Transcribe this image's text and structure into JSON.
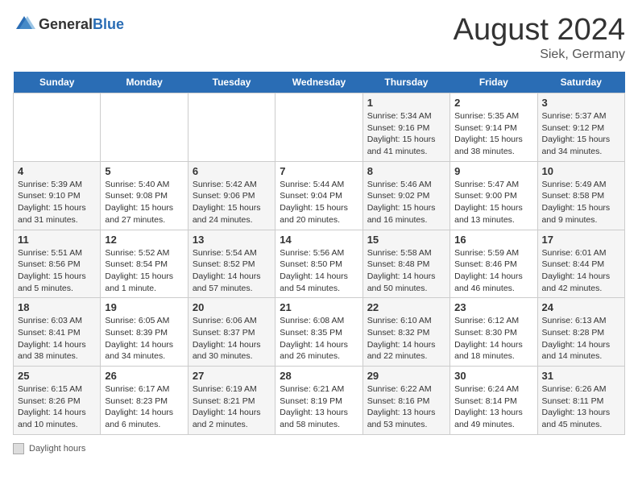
{
  "header": {
    "logo_general": "General",
    "logo_blue": "Blue",
    "month_year": "August 2024",
    "location": "Siek, Germany"
  },
  "days_of_week": [
    "Sunday",
    "Monday",
    "Tuesday",
    "Wednesday",
    "Thursday",
    "Friday",
    "Saturday"
  ],
  "footer": {
    "label": "Daylight hours"
  },
  "weeks": [
    {
      "cells": [
        {
          "date": "",
          "info": ""
        },
        {
          "date": "",
          "info": ""
        },
        {
          "date": "",
          "info": ""
        },
        {
          "date": "",
          "info": ""
        },
        {
          "date": "1",
          "info": "Sunrise: 5:34 AM\nSunset: 9:16 PM\nDaylight: 15 hours\nand 41 minutes."
        },
        {
          "date": "2",
          "info": "Sunrise: 5:35 AM\nSunset: 9:14 PM\nDaylight: 15 hours\nand 38 minutes."
        },
        {
          "date": "3",
          "info": "Sunrise: 5:37 AM\nSunset: 9:12 PM\nDaylight: 15 hours\nand 34 minutes."
        }
      ]
    },
    {
      "cells": [
        {
          "date": "4",
          "info": "Sunrise: 5:39 AM\nSunset: 9:10 PM\nDaylight: 15 hours\nand 31 minutes."
        },
        {
          "date": "5",
          "info": "Sunrise: 5:40 AM\nSunset: 9:08 PM\nDaylight: 15 hours\nand 27 minutes."
        },
        {
          "date": "6",
          "info": "Sunrise: 5:42 AM\nSunset: 9:06 PM\nDaylight: 15 hours\nand 24 minutes."
        },
        {
          "date": "7",
          "info": "Sunrise: 5:44 AM\nSunset: 9:04 PM\nDaylight: 15 hours\nand 20 minutes."
        },
        {
          "date": "8",
          "info": "Sunrise: 5:46 AM\nSunset: 9:02 PM\nDaylight: 15 hours\nand 16 minutes."
        },
        {
          "date": "9",
          "info": "Sunrise: 5:47 AM\nSunset: 9:00 PM\nDaylight: 15 hours\nand 13 minutes."
        },
        {
          "date": "10",
          "info": "Sunrise: 5:49 AM\nSunset: 8:58 PM\nDaylight: 15 hours\nand 9 minutes."
        }
      ]
    },
    {
      "cells": [
        {
          "date": "11",
          "info": "Sunrise: 5:51 AM\nSunset: 8:56 PM\nDaylight: 15 hours\nand 5 minutes."
        },
        {
          "date": "12",
          "info": "Sunrise: 5:52 AM\nSunset: 8:54 PM\nDaylight: 15 hours\nand 1 minute."
        },
        {
          "date": "13",
          "info": "Sunrise: 5:54 AM\nSunset: 8:52 PM\nDaylight: 14 hours\nand 57 minutes."
        },
        {
          "date": "14",
          "info": "Sunrise: 5:56 AM\nSunset: 8:50 PM\nDaylight: 14 hours\nand 54 minutes."
        },
        {
          "date": "15",
          "info": "Sunrise: 5:58 AM\nSunset: 8:48 PM\nDaylight: 14 hours\nand 50 minutes."
        },
        {
          "date": "16",
          "info": "Sunrise: 5:59 AM\nSunset: 8:46 PM\nDaylight: 14 hours\nand 46 minutes."
        },
        {
          "date": "17",
          "info": "Sunrise: 6:01 AM\nSunset: 8:44 PM\nDaylight: 14 hours\nand 42 minutes."
        }
      ]
    },
    {
      "cells": [
        {
          "date": "18",
          "info": "Sunrise: 6:03 AM\nSunset: 8:41 PM\nDaylight: 14 hours\nand 38 minutes."
        },
        {
          "date": "19",
          "info": "Sunrise: 6:05 AM\nSunset: 8:39 PM\nDaylight: 14 hours\nand 34 minutes."
        },
        {
          "date": "20",
          "info": "Sunrise: 6:06 AM\nSunset: 8:37 PM\nDaylight: 14 hours\nand 30 minutes."
        },
        {
          "date": "21",
          "info": "Sunrise: 6:08 AM\nSunset: 8:35 PM\nDaylight: 14 hours\nand 26 minutes."
        },
        {
          "date": "22",
          "info": "Sunrise: 6:10 AM\nSunset: 8:32 PM\nDaylight: 14 hours\nand 22 minutes."
        },
        {
          "date": "23",
          "info": "Sunrise: 6:12 AM\nSunset: 8:30 PM\nDaylight: 14 hours\nand 18 minutes."
        },
        {
          "date": "24",
          "info": "Sunrise: 6:13 AM\nSunset: 8:28 PM\nDaylight: 14 hours\nand 14 minutes."
        }
      ]
    },
    {
      "cells": [
        {
          "date": "25",
          "info": "Sunrise: 6:15 AM\nSunset: 8:26 PM\nDaylight: 14 hours\nand 10 minutes."
        },
        {
          "date": "26",
          "info": "Sunrise: 6:17 AM\nSunset: 8:23 PM\nDaylight: 14 hours\nand 6 minutes."
        },
        {
          "date": "27",
          "info": "Sunrise: 6:19 AM\nSunset: 8:21 PM\nDaylight: 14 hours\nand 2 minutes."
        },
        {
          "date": "28",
          "info": "Sunrise: 6:21 AM\nSunset: 8:19 PM\nDaylight: 13 hours\nand 58 minutes."
        },
        {
          "date": "29",
          "info": "Sunrise: 6:22 AM\nSunset: 8:16 PM\nDaylight: 13 hours\nand 53 minutes."
        },
        {
          "date": "30",
          "info": "Sunrise: 6:24 AM\nSunset: 8:14 PM\nDaylight: 13 hours\nand 49 minutes."
        },
        {
          "date": "31",
          "info": "Sunrise: 6:26 AM\nSunset: 8:11 PM\nDaylight: 13 hours\nand 45 minutes."
        }
      ]
    }
  ]
}
